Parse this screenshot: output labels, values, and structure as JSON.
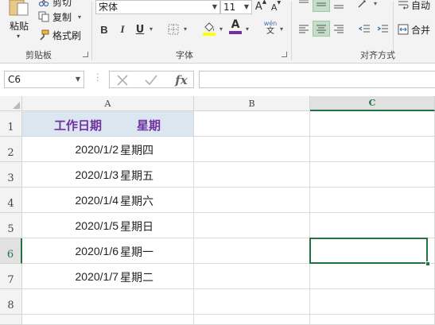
{
  "ribbon": {
    "clipboard": {
      "paste_label": "粘贴",
      "cut_label": "剪切",
      "copy_label": "复制",
      "format_painter_label": "格式刷",
      "group_label": "剪贴板"
    },
    "font": {
      "font_name": "宋体",
      "font_size": "11",
      "bold": "B",
      "italic": "I",
      "underline": "U",
      "font_color_letter": "A",
      "phonetic_top": "wén",
      "phonetic_bottom": "文",
      "group_label": "字体",
      "font_color": "#7030a0",
      "fill_color": "#ffff00"
    },
    "alignment": {
      "wrap_label": "自动",
      "merge_label": "合并",
      "group_label": "对齐方式"
    }
  },
  "formula_bar": {
    "name_box": "C6",
    "fx_label": "fx",
    "formula": ""
  },
  "grid": {
    "columns": [
      "A",
      "B",
      "C"
    ],
    "selected_column": "C",
    "rows": [
      "1",
      "2",
      "3",
      "4",
      "5",
      "6",
      "7",
      "8"
    ],
    "selected_row": "6",
    "header": {
      "date": "工作日期",
      "weekday": "星期"
    },
    "data": [
      {
        "date": "2020/1/2",
        "weekday": "星期四"
      },
      {
        "date": "2020/1/3",
        "weekday": "星期五"
      },
      {
        "date": "2020/1/4",
        "weekday": "星期六"
      },
      {
        "date": "2020/1/5",
        "weekday": "星期日"
      },
      {
        "date": "2020/1/6",
        "weekday": "星期一"
      },
      {
        "date": "2020/1/7",
        "weekday": "星期二"
      }
    ],
    "header_fill_color": "#dce6f1",
    "header_text_color": "#7030a0",
    "selection_color": "#217346"
  }
}
